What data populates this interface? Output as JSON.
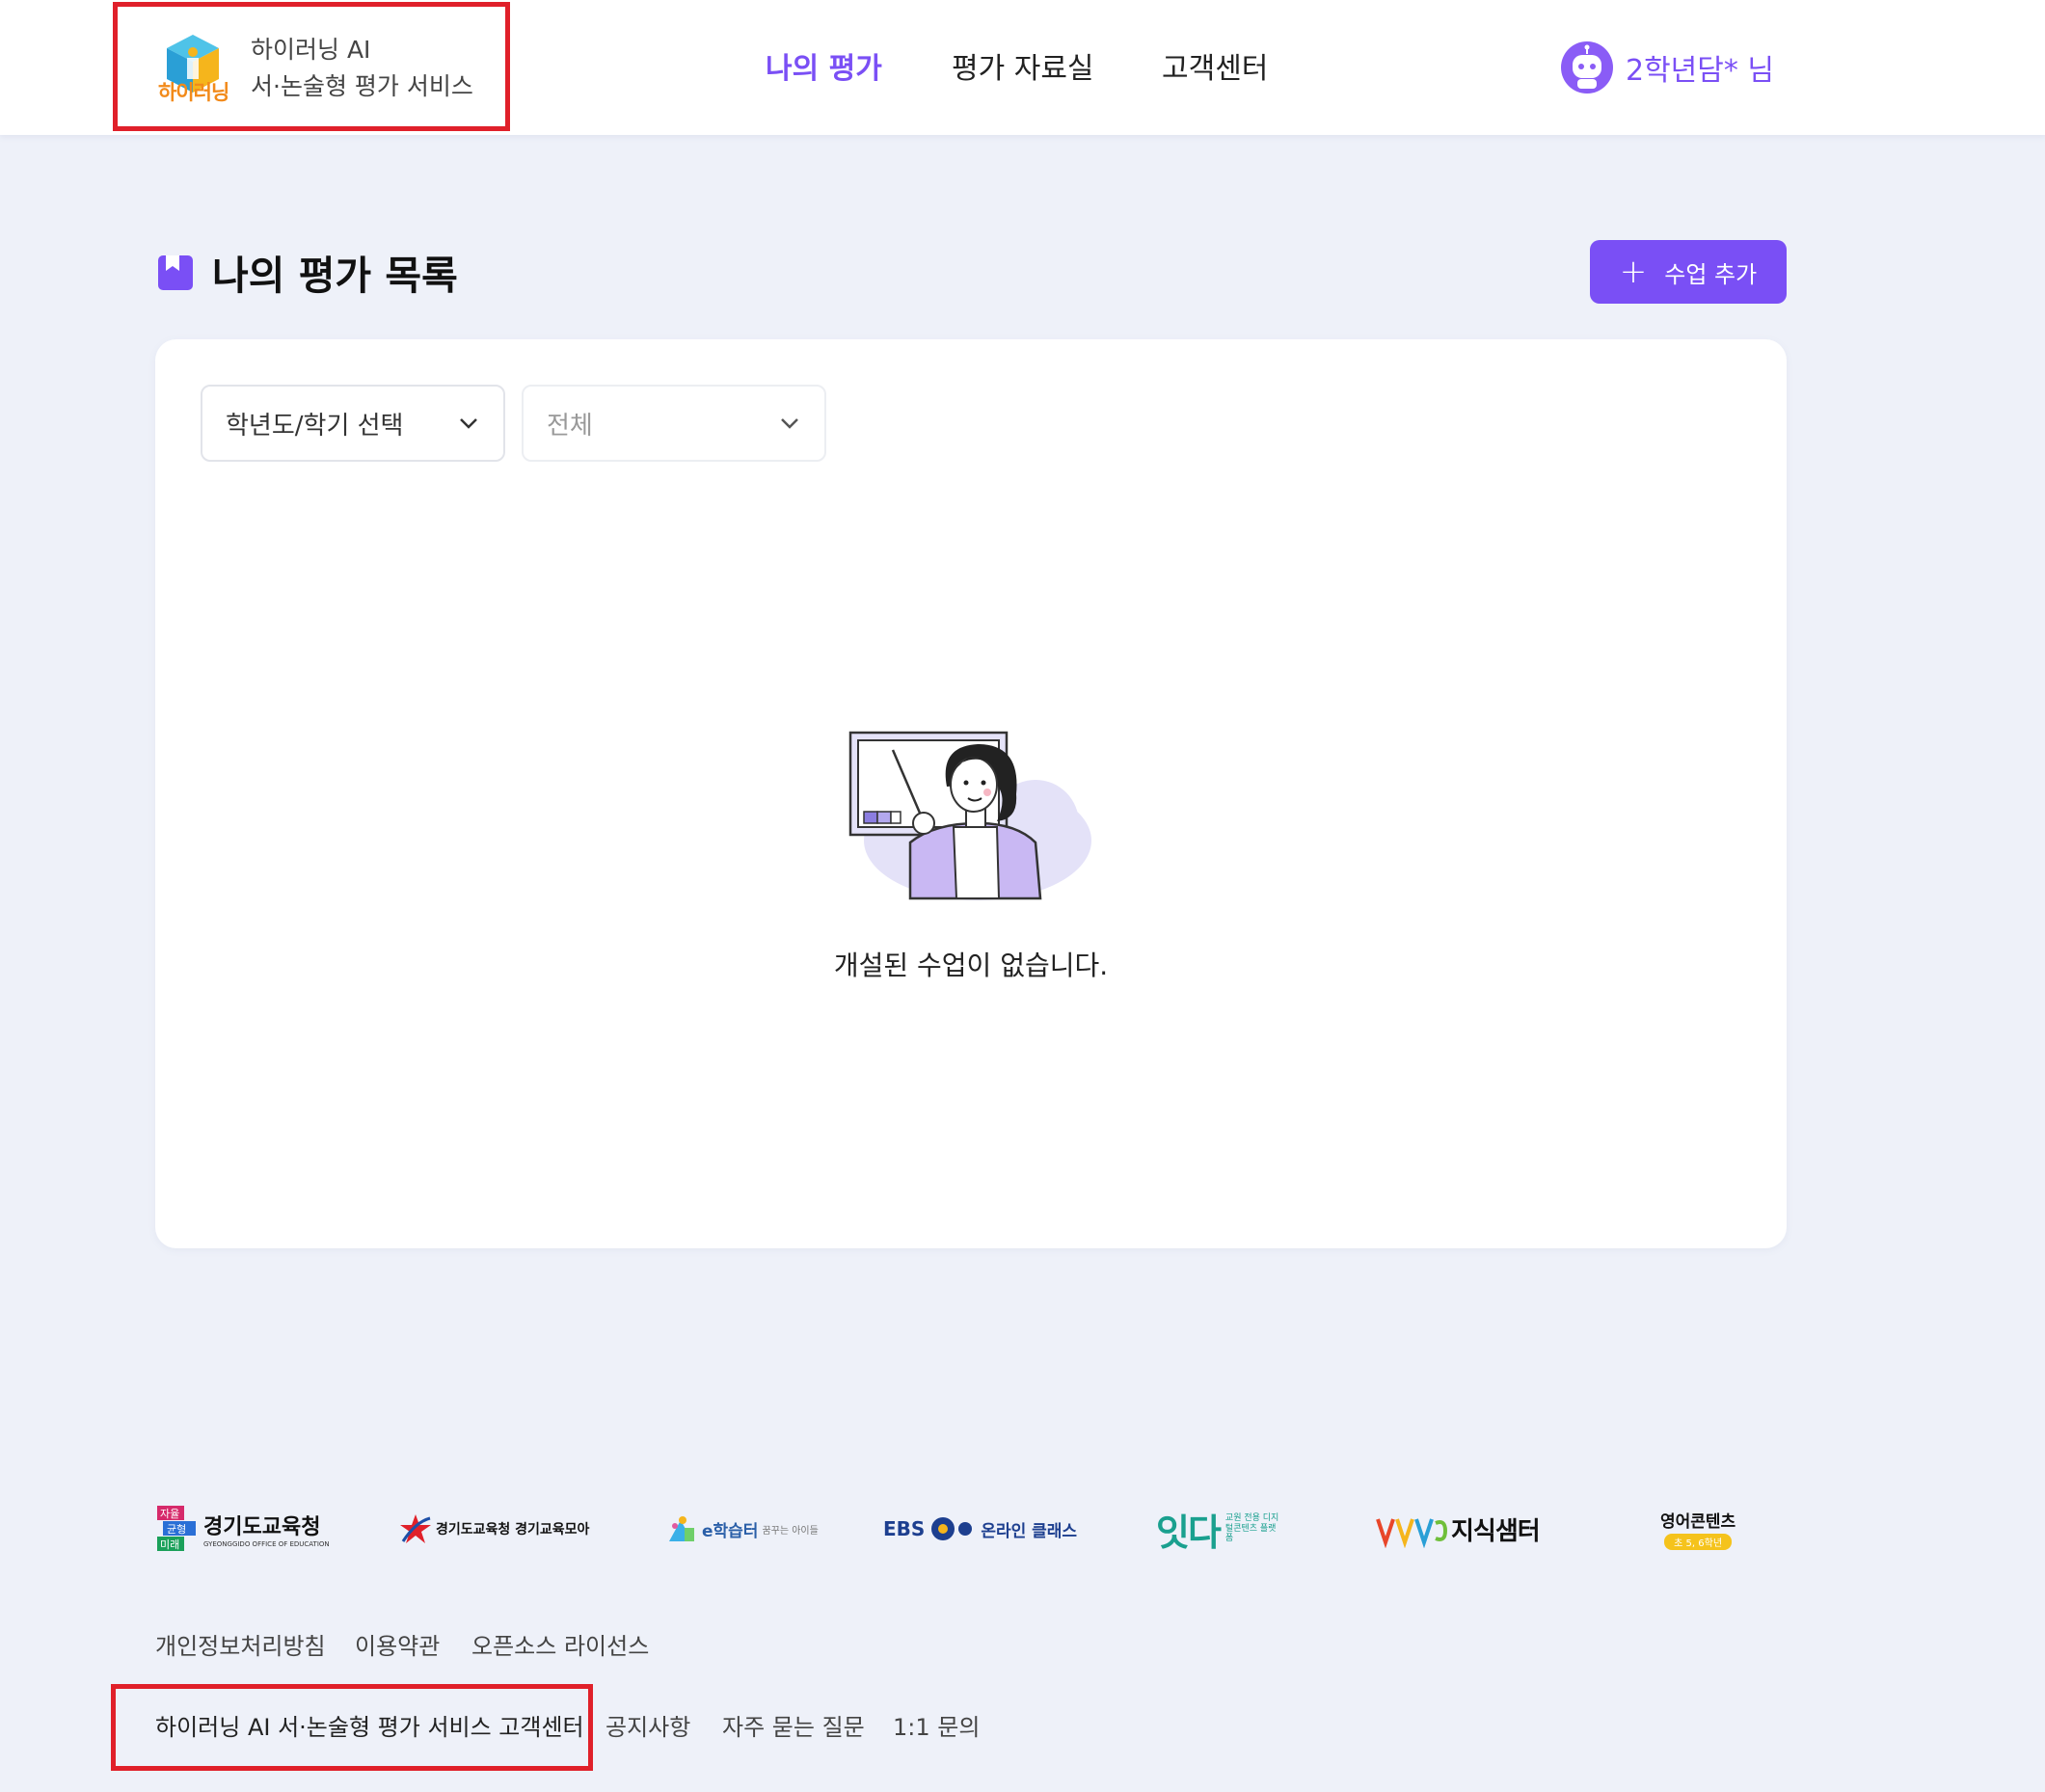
{
  "header": {
    "logo_word": "하이러닝",
    "service_line1": "하이러닝 AI",
    "service_line2": "서·논술형 평가 서비스",
    "nav": [
      {
        "label": "나의 평가",
        "active": true
      },
      {
        "label": "평가 자료실",
        "active": false
      },
      {
        "label": "고객센터",
        "active": false
      }
    ],
    "user_name": "2학년담* 님"
  },
  "main": {
    "title": "나의 평가 목록",
    "add_button": "수업 추가",
    "filters": {
      "year_semester": "학년도/학기 선택",
      "category": "전체"
    },
    "empty_message": "개설된 수업이 없습니다."
  },
  "footer": {
    "partners": [
      {
        "name": "경기도교육청",
        "sub": "GYEONGGIDO OFFICE OF EDUCATION",
        "badge": [
          "자율",
          "균형",
          "미래"
        ]
      },
      {
        "name": "경기도교육청 경기교육모아"
      },
      {
        "name": "e학습터",
        "sub": "꿈꾸는 아이들"
      },
      {
        "name": "EBS",
        "sub": "온라인 클래스"
      },
      {
        "name": "잇다",
        "sub": "교원 전용 디지털콘텐츠 플랫폼"
      },
      {
        "name": "지식샘터"
      },
      {
        "name": "영어콘텐츠",
        "sub": "초 5, 6학년"
      }
    ],
    "links_row1": [
      "개인정보처리방침",
      "이용약관",
      "오픈소스 라이선스"
    ],
    "links_row2": [
      "하이러닝 AI 서·논술형 평가 서비스 고객센터",
      "공지사항",
      "자주 묻는 질문",
      "1:1 문의"
    ]
  },
  "colors": {
    "accent": "#7a4ff5",
    "background": "#eef1f9",
    "highlight_box": "#e0202a",
    "logo_orange": "#f28a1a"
  },
  "icons": [
    "hi-learning-logo-icon",
    "robot-avatar-icon",
    "bookmark-icon",
    "plus-icon",
    "chevron-down-icon",
    "teacher-illustration"
  ]
}
